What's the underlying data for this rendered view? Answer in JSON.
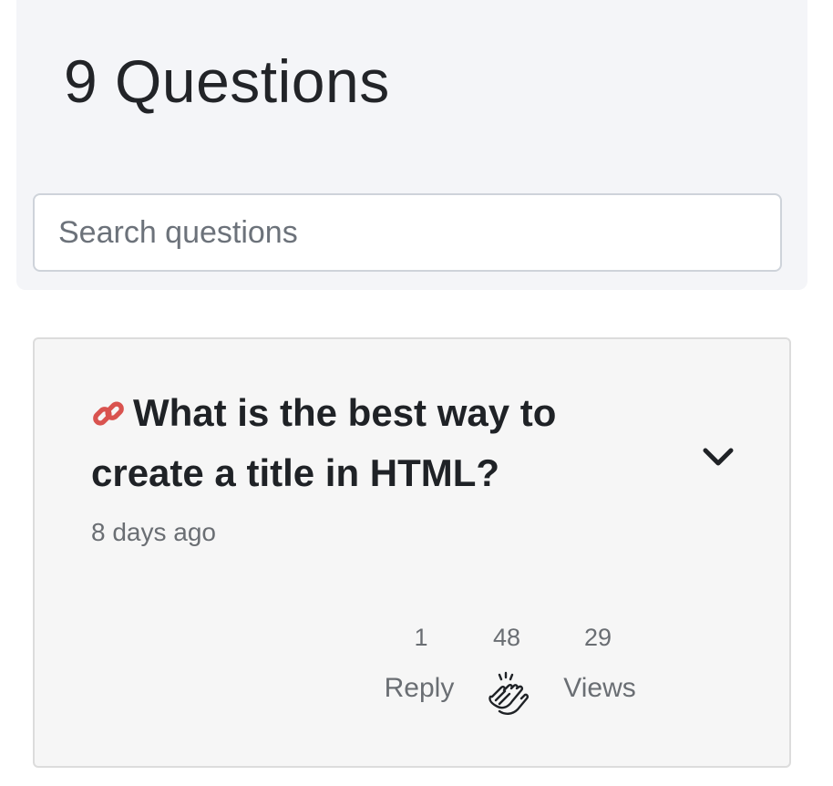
{
  "header": {
    "title": "9 Questions",
    "search": {
      "placeholder": "Search questions",
      "value": ""
    }
  },
  "question": {
    "title": "What is the best way to create a title in HTML?",
    "time_ago": "8 days ago",
    "icons": {
      "link": "link-icon",
      "expand": "chevron-down-icon",
      "clap": "clap-icon"
    },
    "stats": {
      "replies": {
        "count": "1",
        "label": "Reply"
      },
      "claps": {
        "count": "48"
      },
      "views": {
        "count": "29",
        "label": "Views"
      }
    }
  },
  "colors": {
    "header_bg": "#f4f5f8",
    "card_bg": "#f6f6f6",
    "link_icon": "#d9534f",
    "text_dark": "#1f2226",
    "text_muted": "#6a6e73"
  }
}
